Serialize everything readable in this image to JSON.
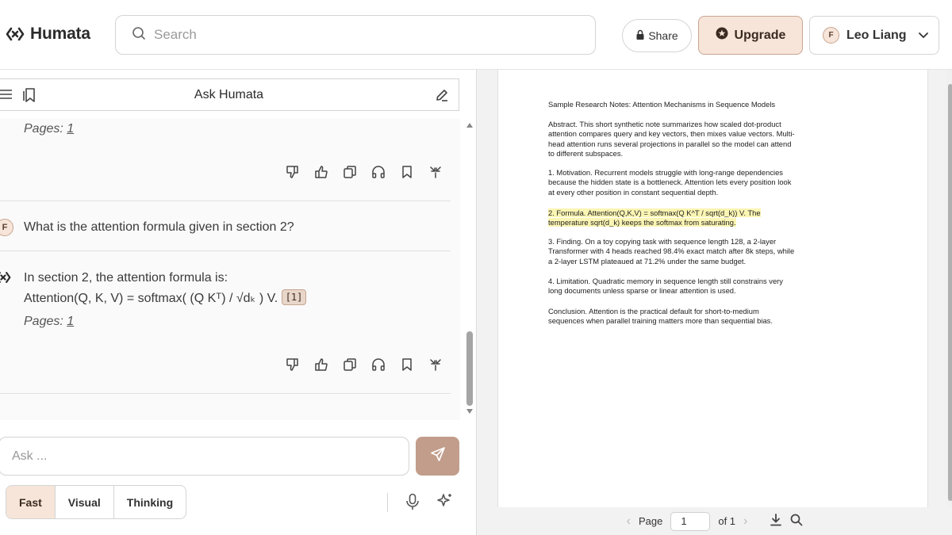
{
  "app": {
    "brand": "Humata"
  },
  "header": {
    "search_placeholder": "Search",
    "share_label": "Share",
    "upgrade_label": "Upgrade",
    "user_initial": "F",
    "user_name": "Leo Liang"
  },
  "chat": {
    "title": "Ask Humata",
    "prev_pages_label": "Pages:",
    "prev_pages_link": "1",
    "question_initial": "F",
    "question": "What is the attention formula given in section 2?",
    "answer_line1": "In section 2, the attention formula is:",
    "answer_line2": "Attention(Q, K, V) = softmax( (Q Kᵀ) / √dₖ ) V.",
    "answer_citation": "[1]",
    "answer_pages_label": "Pages:",
    "answer_pages_link": "1",
    "ask_placeholder": "Ask ...",
    "modes": [
      "Fast",
      "Visual",
      "Thinking"
    ],
    "active_mode": "Fast"
  },
  "document": {
    "title": "Sample Research Notes: Attention Mechanisms in Sequence Models",
    "abstract": "Abstract. This short synthetic note summarizes how scaled dot-product attention compares query and key vectors, then mixes value vectors. Multi-head attention runs several projections in parallel so the model can attend to different subspaces.",
    "motivation": "1. Motivation. Recurrent models struggle with long-range dependencies because the hidden state is a bottleneck. Attention lets every position look at every other position in constant sequential depth.",
    "formula": "2. Formula. Attention(Q,K,V) = softmax(Q K^T / sqrt(d_k)) V. The temperature sqrt(d_k) keeps the softmax from saturating.",
    "finding": "3. Finding. On a toy copying task with sequence length 128, a 2-layer Transformer with 4 heads reached 98.4% exact match after 8k steps, while a 2-layer LSTM plateaued at 71.2% under the same budget.",
    "limitation": "4. Limitation. Quadratic memory in sequence length still constrains very long documents unless sparse or linear attention is used.",
    "conclusion": "Conclusion. Attention is the practical default for short-to-medium sequences when parallel training matters more than sequential bias."
  },
  "viewer": {
    "page_label": "Page",
    "page_value": "1",
    "page_total": "of 1"
  },
  "colors": {
    "accent": "#f6e5d8",
    "accent_border": "#c9a592",
    "send_button": "#c29d8b",
    "highlight": "#fbf5b3"
  }
}
